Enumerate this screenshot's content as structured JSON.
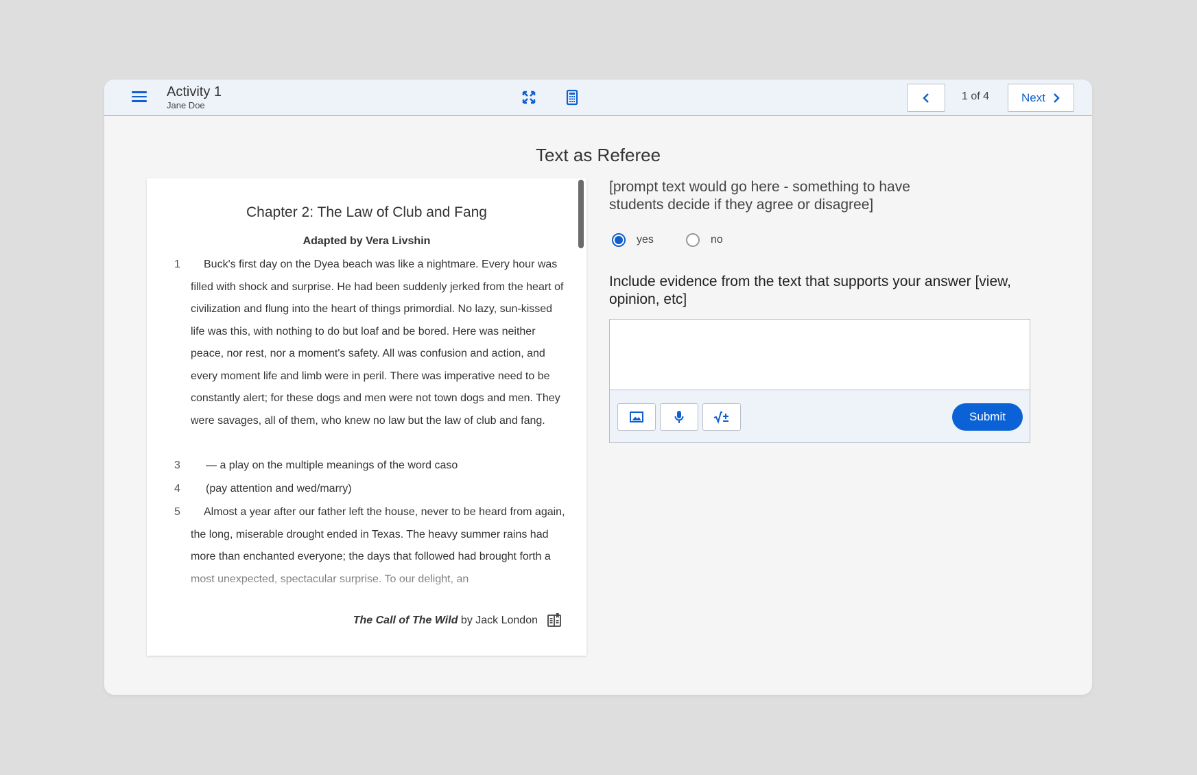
{
  "header": {
    "title": "Activity 1",
    "student": "Jane Doe",
    "page_indicator": "1 of 4",
    "next_label": "Next"
  },
  "activity_title": "Text as Referee",
  "reading": {
    "chapter_title": "Chapter 2: The Law of Club and Fang",
    "adapted_by": "Adapted by Vera Livshin",
    "paragraphs": [
      {
        "num": "1",
        "text": "Buck's first day on the Dyea beach was like a nightmare. Every hour was filled with shock and surprise. He had been suddenly jerked from the heart of civilization and flung into the heart of things primordial. No lazy, sun-kissed life was this, with nothing to do but loaf and be bored. Here was neither peace, nor rest, nor a moment's safety. All was confusion and action, and every moment life and limb were in peril. There was imperative need to be constantly alert; for these dogs and men were not town dogs and men. They were savages, all of them, who knew no law but the law of club and fang."
      },
      {
        "num": "3",
        "text": "— a play on the multiple meanings of the word caso"
      },
      {
        "num": "4",
        "text": "(pay attention and wed/marry)"
      },
      {
        "num": "5",
        "text": "Almost a year after our father left the house, never to be heard from again, the long, miserable drought ended in Texas. The heavy summer rains had more than enchanted everyone; the days that followed had brought forth a most unexpected, spectacular surprise. To our delight, an"
      }
    ],
    "citation_title": "The Call of The Wild",
    "citation_author": " by Jack London"
  },
  "question": {
    "prompt": "[prompt text would go here - something to have students decide if they agree or disagree]",
    "options": [
      {
        "label": "yes",
        "selected": true
      },
      {
        "label": "no",
        "selected": false
      }
    ],
    "evidence_label": "Include evidence from the text that supports your answer [view, opinion, etc]",
    "answer_value": "",
    "submit_label": "Submit"
  },
  "colors": {
    "accent": "#0f5fcf",
    "submit": "#0a62d6",
    "background": "#dedede",
    "panel": "#f5f5f5",
    "toolbar": "#eef3fa"
  }
}
